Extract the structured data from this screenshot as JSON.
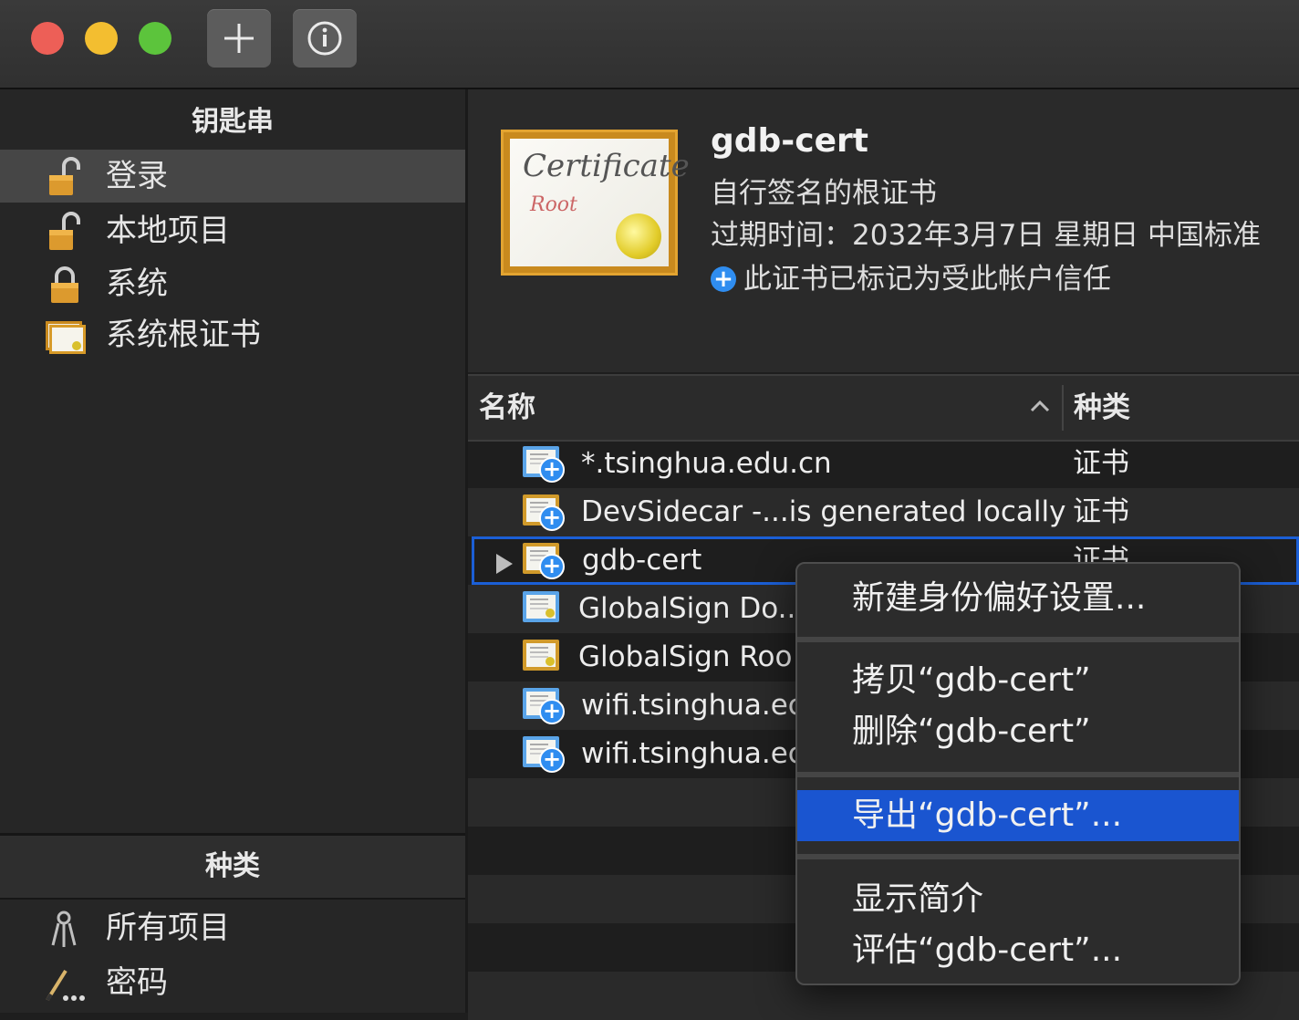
{
  "toolbar": {
    "add_label": "+",
    "info_label": "i"
  },
  "sidebar": {
    "keychains_title": "钥匙串",
    "keychains": [
      {
        "label": "登录",
        "icon": "unlocked-padlock-icon",
        "selected": true
      },
      {
        "label": "本地项目",
        "icon": "unlocked-padlock-icon",
        "selected": false
      },
      {
        "label": "系统",
        "icon": "locked-padlock-icon",
        "selected": false
      },
      {
        "label": "系统根证书",
        "icon": "certificate-stack-icon",
        "selected": false
      }
    ],
    "category_title": "种类",
    "categories": [
      {
        "label": "所有项目",
        "icon": "keys-icon"
      },
      {
        "label": "密码",
        "icon": "pencil-dots-icon"
      }
    ]
  },
  "detail": {
    "name": "gdb-cert",
    "subtitle": "自行签名的根证书",
    "expiry": "过期时间：2032年3月7日 星期日 中国标准",
    "trust": "此证书已标记为受此帐户信任",
    "certificate_text_1": "Certificate",
    "certificate_text_2": "Root"
  },
  "table": {
    "col_name": "名称",
    "col_kind": "种类",
    "rows": [
      {
        "name": "*.tsinghua.edu.cn",
        "kind": "证书",
        "icon": "cert-blue"
      },
      {
        "name": "DevSidecar -...is generated locally",
        "kind": "证书",
        "icon": "cert-gold"
      },
      {
        "name": "gdb-cert",
        "kind": "证书",
        "icon": "cert-gold",
        "selected": true
      },
      {
        "name": "GlobalSign Do...",
        "kind": "",
        "icon": "cert-blue-plain"
      },
      {
        "name": "GlobalSign Roo",
        "kind": "",
        "icon": "cert-gold-plain"
      },
      {
        "name": "wifi.tsinghua.ec",
        "kind": "",
        "icon": "cert-blue"
      },
      {
        "name": "wifi.tsinghua.ec",
        "kind": "",
        "icon": "cert-blue"
      }
    ]
  },
  "context_menu": {
    "items": [
      "新建身份偏好设置...",
      "拷贝“gdb-cert”",
      "删除“gdb-cert”",
      "导出“gdb-cert”...",
      "显示简介",
      "评估“gdb-cert”..."
    ],
    "highlighted_index": 3
  },
  "colors": {
    "accent": "#1a55d0",
    "selection_outline": "#1b5fd6",
    "trust_blue": "#2f8df0"
  }
}
